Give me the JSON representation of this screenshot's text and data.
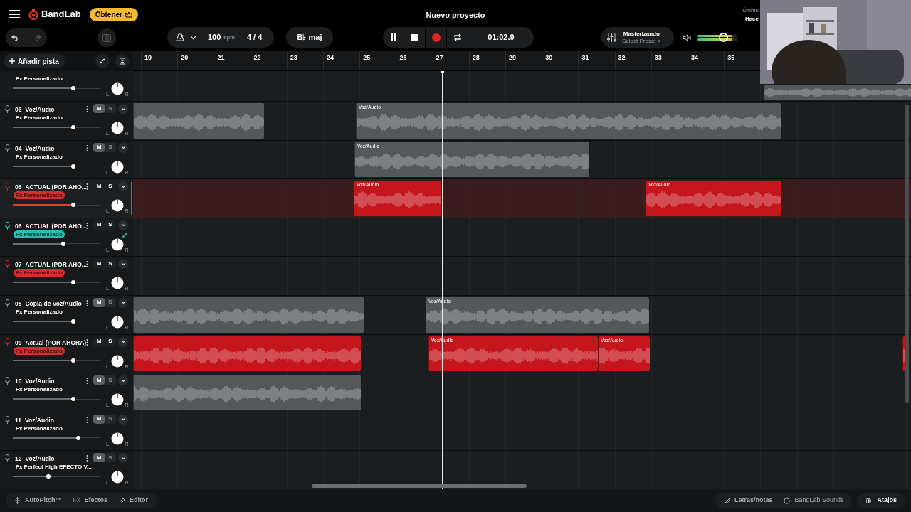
{
  "app": {
    "brand": "BandLab",
    "upgrade_button": "Obtener",
    "project_title": "Nuevo proyecto",
    "save_status": [
      "Último",
      "Hace"
    ]
  },
  "transport": {
    "tempo": "100",
    "tempo_unit": "bpm",
    "time_signature": "4 / 4",
    "key": "B♭ maj",
    "time": "01:02.9",
    "recording": true,
    "playing": true
  },
  "mastering": {
    "title": "Masterizando",
    "preset": "Select Preset >"
  },
  "master_volume": {
    "level": 0.66
  },
  "add_track_button": "Añadir pista",
  "ruler": [
    "19",
    "20",
    "21",
    "22",
    "23",
    "24",
    "25",
    "26",
    "27",
    "28",
    "29",
    "30",
    "31",
    "32",
    "33",
    "34",
    "35"
  ],
  "tracks": [
    {
      "kind": "partial",
      "fx": {
        "label": "Fx Personalizado"
      },
      "level": 0.7,
      "selected": false,
      "pan_left": "L",
      "pan_right": "R",
      "clips": [
        {
          "color": "#55585b"
        }
      ]
    },
    {
      "kind": "full",
      "number": "03",
      "name": "Voz/Audio",
      "fx": {
        "label": "Fx Personalizado"
      },
      "mute_label": "M",
      "solo_label": "S",
      "muted": true,
      "armed": false,
      "level": 0.7,
      "selected": false,
      "pan_left": "L",
      "pan_right": "R",
      "clips": [
        {
          "color": "#55585b"
        },
        {
          "label": "Voz/Audio",
          "color": "#55585b"
        }
      ]
    },
    {
      "kind": "full",
      "number": "04",
      "name": "Voz/Audio",
      "fx": {
        "label": "Fx Personalizado"
      },
      "mute_label": "M",
      "solo_label": "S",
      "muted": true,
      "armed": false,
      "level": 0.7,
      "selected": false,
      "pan_left": "L",
      "pan_right": "R",
      "clips": [
        {
          "label": "Voz/Audio",
          "color": "#55585b"
        }
      ]
    },
    {
      "kind": "full",
      "number": "05",
      "name": "ACTUAL (POR AHO...",
      "fx": {
        "label": "Fx Personalizado",
        "color": "#d32f2f"
      },
      "mute_label": "M",
      "solo_label": "S",
      "muted": false,
      "armed": true,
      "level": 0.7,
      "selected": true,
      "pan_left": "L",
      "pan_right": "R",
      "clips": [
        {
          "label": "Voz/Audio",
          "color": "#c4161c"
        },
        {
          "label": "Voz/Audio",
          "color": "#c4161c"
        }
      ]
    },
    {
      "kind": "full",
      "number": "06",
      "name": "ACTUAL (POR AHO...",
      "fx": {
        "label": "Fx Personalizado",
        "color": "#2bbfb3"
      },
      "mute_label": "M",
      "solo_label": "S",
      "muted": false,
      "armed": false,
      "monitoring": true,
      "level": 0.58,
      "selected": false,
      "automation": true,
      "pan_left": "L",
      "pan_right": "R"
    },
    {
      "kind": "full",
      "number": "07",
      "name": "ACTUAL (POR AHO...",
      "fx": {
        "label": "Fx Personalizado",
        "color": "#d32f2f"
      },
      "mute_label": "M",
      "solo_label": "S",
      "muted": false,
      "armed": true,
      "level": 0.7,
      "selected": false,
      "pan_left": "L",
      "pan_right": "R"
    },
    {
      "kind": "full",
      "number": "08",
      "name": "Copia de Voz/Audio",
      "fx": {
        "label": "Fx Personalizado"
      },
      "mute_label": "M",
      "solo_label": "S",
      "muted": true,
      "armed": false,
      "level": 0.7,
      "selected": false,
      "pan_left": "L",
      "pan_right": "R",
      "clips": [
        {
          "color": "#55585b"
        },
        {
          "label": "Voz/Audio",
          "color": "#55585b"
        }
      ]
    },
    {
      "kind": "full",
      "number": "09",
      "name": "Actual (POR AHORA)",
      "fx": {
        "label": "Fx Personalizado",
        "color": "#d32f2f"
      },
      "mute_label": "M",
      "solo_label": "S",
      "muted": false,
      "armed": true,
      "level": 0.7,
      "selected": false,
      "pan_left": "L",
      "pan_right": "R",
      "clips": [
        {
          "color": "#c4161c"
        },
        {
          "label": "Voz/Audio",
          "color": "#c4161c"
        },
        {
          "label": "Voz/Audio",
          "color": "#c4161c"
        },
        {
          "color": "#c4161c"
        }
      ]
    },
    {
      "kind": "full",
      "number": "10",
      "name": "Voz/Audio",
      "fx": {
        "label": "Fx Personalizado"
      },
      "mute_label": "M",
      "solo_label": "S",
      "muted": true,
      "armed": false,
      "level": 0.7,
      "selected": false,
      "pan_left": "L",
      "pan_right": "R",
      "clips": [
        {
          "color": "#55585b"
        }
      ]
    },
    {
      "kind": "full",
      "number": "11",
      "name": "Voz/Audio",
      "fx": {
        "label": "Fx Personalizado"
      },
      "mute_label": "M",
      "solo_label": "S",
      "muted": true,
      "armed": false,
      "level": 0.75,
      "selected": false,
      "pan_left": "L",
      "pan_right": "R"
    },
    {
      "kind": "full",
      "number": "12",
      "name": "Voz/Audio",
      "fx": {
        "label": "Fx Perfect High EFECTO V..."
      },
      "mute_label": "M",
      "solo_label": "S",
      "muted": true,
      "armed": false,
      "level": 0.41,
      "selected": false,
      "pan_left": "L",
      "pan_right": "R"
    }
  ],
  "bottom_left": [
    {
      "kind": "autopitch",
      "label": "AutoPitch™"
    },
    {
      "kind": "fx",
      "label": "Efectos",
      "prefix": "Fx"
    },
    {
      "kind": "editor",
      "label": "Editor"
    }
  ],
  "bottom_right": [
    {
      "kind": "lyrics",
      "label": "Letras/notas"
    },
    {
      "kind": "sounds",
      "label": "BandLab Sounds"
    }
  ],
  "shortcuts_button": "Atajos"
}
